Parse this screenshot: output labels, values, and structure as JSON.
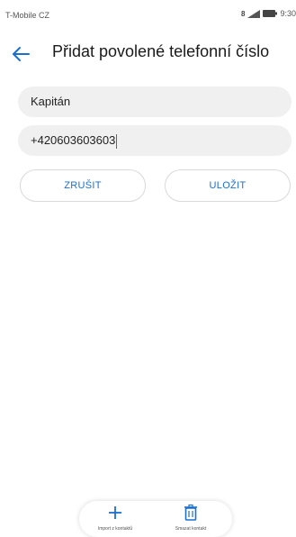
{
  "status_bar": {
    "carrier": "T-Mobile CZ",
    "time": "9:30",
    "sim_label": "8"
  },
  "header": {
    "title": "Přidat povolené telefonní číslo"
  },
  "form": {
    "name_value": "Kapitán",
    "phone_value": "+420603603603"
  },
  "buttons": {
    "cancel": "ZRUŠIT",
    "save": "ULOŽIT"
  },
  "bottom_actions": {
    "import_label": "Import z kontaktů",
    "delete_label": "Smazat kontakt"
  },
  "icons": {
    "back": "arrow-left-icon",
    "import": "plus-icon",
    "delete": "trash-icon"
  },
  "colors": {
    "accent": "#1b6fd1",
    "field_bg": "#f0f0f0"
  }
}
